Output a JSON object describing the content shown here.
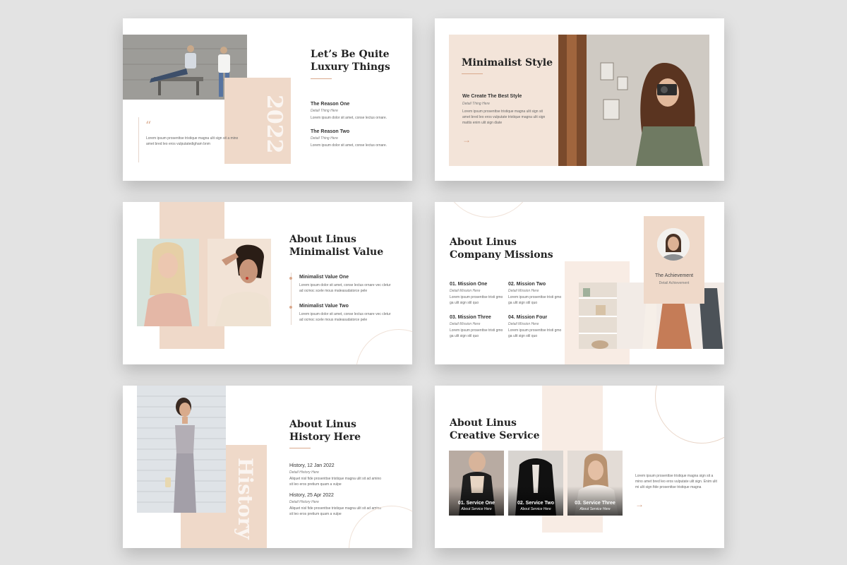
{
  "colors": {
    "peach": "#efd9c9",
    "accent": "#d9a98d",
    "background": "#e3e3e3"
  },
  "slide1": {
    "title": "Let’s Be Quite\nLuxury Things",
    "year": "2022",
    "quote_icon": "quote-icon",
    "quote": "Lorem ipsum prosenttse tristique magna ulit sign sit a mino amet bred leo eros vulputatedigham bnm",
    "reasons": [
      {
        "title": "The Reason One",
        "sub": "Detail Thing Here",
        "body": "Lorem ipsum dolor sit amet, conse lectus ornare."
      },
      {
        "title": "The Reason Two",
        "sub": "Detail Thing Here",
        "body": "Lorem ipsum dolor sit amet, conse lectus ornare."
      }
    ]
  },
  "slide2": {
    "title": "Minimalist Style",
    "heading": "We Create The Best Style",
    "sub": "Detail Thing Here",
    "body": "Lorem ipsum prosenttse tristique magna ulit sign sit amet bred leo eros vulputate tristique magna ulit sign mattis enim ulit sign diate",
    "arrow": "→"
  },
  "slide3": {
    "title": "About Linus\nMinimalist Value",
    "items": [
      {
        "title": "Minimalist Value One",
        "body": "Lorem ipsum dolor sit amet, conse lectus ornare vec cletur ad ocmoc scele mous maleasudatorce pele"
      },
      {
        "title": "Minimalist Value Two",
        "body": "Lorem ipsum dolor sit amet, conse lectus ornare vec cletur ad ocmoc scele mous maleasudatorce pele"
      }
    ]
  },
  "slide4": {
    "title": "About Linus\nCompany Missions",
    "missions": [
      {
        "title": "01. Mission One",
        "sub": "Detail Mission Here",
        "body": "Lorem ipsum prosenttse tristi gmo ga ulit sign stil quo"
      },
      {
        "title": "02. Mission Two",
        "sub": "Detail Mission Here",
        "body": "Lorem ipsum prosenttse tristi gmo ga ulit sign stil quo"
      },
      {
        "title": "03. Mission Three",
        "sub": "Detail Mission Here",
        "body": "Lorem ipsum prosenttse tristi gmo ga ulit sign stil quo"
      },
      {
        "title": "04. Mission Four",
        "sub": "Detail Mission Here",
        "body": "Lorem ipsum prosenttse tristi gmo ga ulit sign stil quo"
      }
    ],
    "achievement": "The Achievement",
    "achievement_sub": "Detail Achievement"
  },
  "slide5": {
    "title": "About Linus\nHistory Here",
    "vertical": "History",
    "items": [
      {
        "title": "History, 12 Jan 2022",
        "sub": "Detail History Here",
        "body": "Aliquet nisl fide prosenttse tristique magna ulit sit ad amino sit leo eros pretium quam a vulpe"
      },
      {
        "title": "History, 25 Apr 2022",
        "sub": "Detail History Here",
        "body": "Aliquet nisl fide prosenttse tristique magna ulit sit ad amino sit leo eros pretium quam a vulpe"
      }
    ]
  },
  "slide6": {
    "title": "About Linus\nCreative Service",
    "services": [
      {
        "title": "01. Service One",
        "sub": "About Service Here"
      },
      {
        "title": "02. Service Two",
        "sub": "About Service Here"
      },
      {
        "title": "03. Service Three",
        "sub": "About Service Here"
      }
    ],
    "body": "Lorem ipsum prosenttse tristique magna sign sit a mino amet bred leo eros vulputate ulit sign. Enim ulit mi ulit sign fide prosenttse tristique magna",
    "arrow": "→"
  }
}
